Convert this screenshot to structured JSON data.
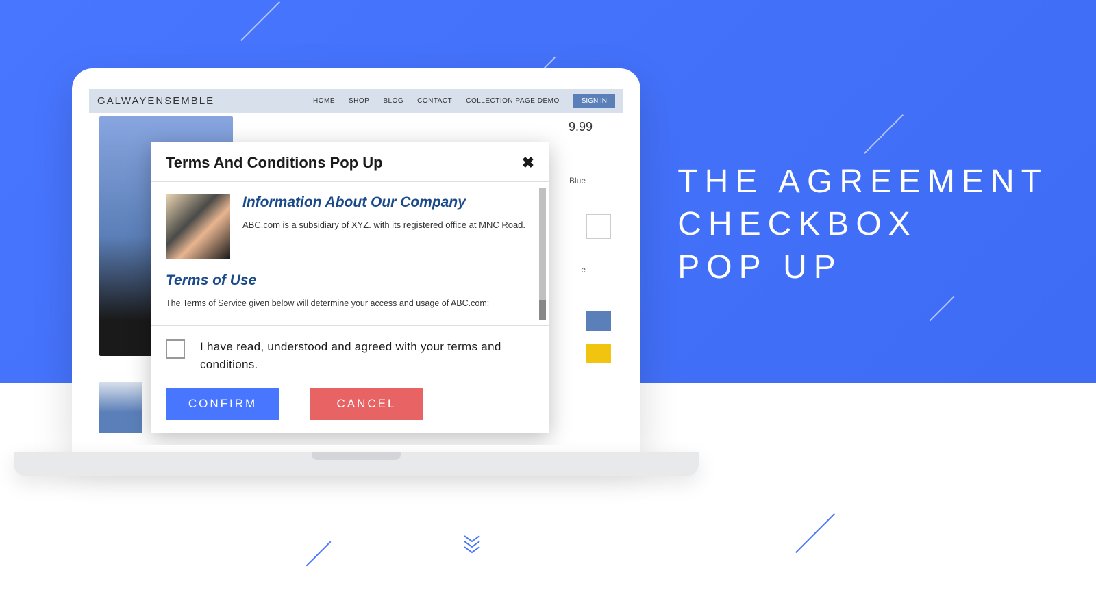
{
  "hero": {
    "line1": "THE AGREEMENT",
    "line2": "CHECKBOX",
    "line3": "POP UP"
  },
  "site": {
    "logo_bold": "GALWAY",
    "logo_thin": "ENSEMBLE",
    "nav": {
      "home": "HOME",
      "shop": "SHOP",
      "blog": "BLOG",
      "contact": "CONTACT",
      "collection": "COLLECTION PAGE DEMO"
    },
    "signin": "SIGN IN"
  },
  "product": {
    "price": "9.99",
    "color_label": "Blue",
    "variant_letter": "e"
  },
  "modal": {
    "title": "Terms And Conditions Pop Up",
    "company": {
      "heading": "Information About Our Company",
      "body": "ABC.com is a subsidiary of XYZ. with its registered office at MNC Road."
    },
    "terms": {
      "heading": "Terms of Use",
      "body": "The Terms of Service given below will determine your access and usage of ABC.com:"
    },
    "agree_text": "I have read, understood and agreed with your terms and conditions.",
    "confirm": "CONFIRM",
    "cancel": "CANCEL"
  }
}
